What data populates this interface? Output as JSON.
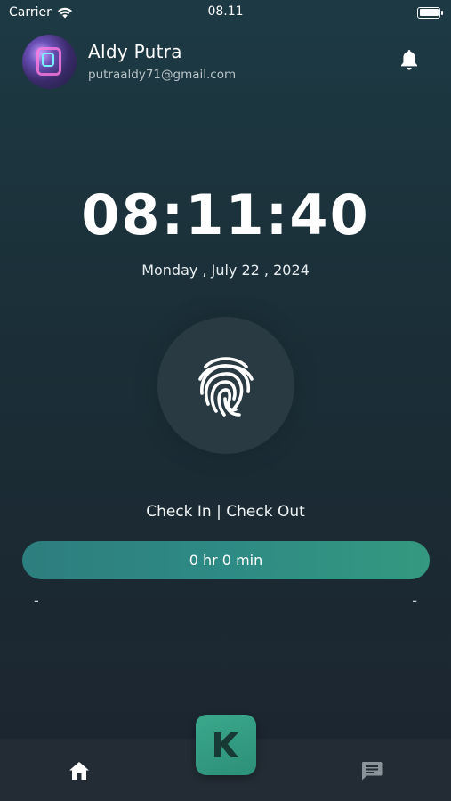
{
  "status_bar": {
    "carrier": "Carrier",
    "time": "08.11"
  },
  "user": {
    "name": "Aldy Putra",
    "email": "putraaldy71@gmail.com"
  },
  "clock": {
    "time": "08:11:40",
    "date": "Monday , July 22 , 2024"
  },
  "attendance": {
    "label": "Check In | Check Out",
    "duration": "0 hr 0 min",
    "check_in_time": "-",
    "check_out_time": "-"
  },
  "icons": {
    "wifi": "wifi-icon",
    "battery": "battery-icon",
    "notification": "bell-icon",
    "fingerprint": "fingerprint-icon",
    "home": "home-icon",
    "chat": "chat-icon",
    "app_logo": "k-logo-icon"
  },
  "colors": {
    "accent": "#2e8a84",
    "fab": "#3aa88c",
    "nav_background": "#232c35"
  }
}
